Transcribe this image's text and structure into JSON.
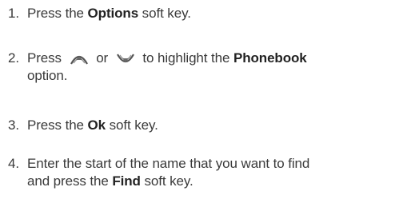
{
  "steps": [
    {
      "number": "1.",
      "pre": "Press the ",
      "bold": "Options",
      "post": " soft key."
    },
    {
      "number": "2.",
      "pre": "Press ",
      "mid": " or ",
      "pre2": " to highlight the ",
      "bold": "Phonebook",
      "cont": "option.",
      "icon_up": "scroll-up-key-icon",
      "icon_down": "scroll-down-key-icon"
    },
    {
      "number": "3.",
      "pre": "Press the ",
      "bold": "Ok",
      "post": " soft key."
    },
    {
      "number": "4.",
      "line1": "Enter the start of the name that you want to find",
      "pre": "and press the ",
      "bold": "Find",
      "post": " soft key."
    }
  ]
}
